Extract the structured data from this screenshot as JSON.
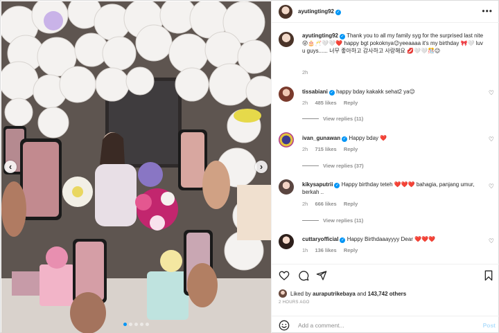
{
  "post": {
    "author": "ayutingting92",
    "caption_user": "ayutingting92",
    "caption": "Thank you to all my family syg for the surprised last nite 😜🎂🥂🤍🤍❤️ happy bgt pokoknya😉yeeaaaa it's my birthday 🎀🤍 luv u guys...... 너무 좋아하고 감사하고 사랑해요 💋🤍🤍🎊😉",
    "caption_time": "2h",
    "carousel": {
      "total": 5,
      "active": 0
    }
  },
  "comments": [
    {
      "user": "tissabiani",
      "verified": true,
      "text": "happy bday kakakk sehat2 ya😉",
      "time": "2h",
      "likes": "485 likes",
      "reply": "Reply",
      "view_replies": "View replies (11)"
    },
    {
      "user": "ivan_gunawan",
      "verified": true,
      "text": "Happy bday ❤️",
      "time": "2h",
      "likes": "715 likes",
      "reply": "Reply",
      "view_replies": "View replies (37)"
    },
    {
      "user": "kikysaputrii",
      "verified": true,
      "text": "Happy birthday teteh ❤️❤️❤️ bahagia, panjang umur, berkah ..",
      "time": "2h",
      "likes": "666 likes",
      "reply": "Reply",
      "view_replies": "View replies (11)"
    },
    {
      "user": "cuttaryofficial",
      "verified": true,
      "text": "Happy Birthdaaayyyy Dear ❤️❤️❤️",
      "time": "1h",
      "likes": "136 likes",
      "reply": "Reply"
    }
  ],
  "likes": {
    "prefix": "Liked by ",
    "user": "auraputrikebaya",
    "middle": " and ",
    "count": "143,742 others"
  },
  "timestamp": "2 HOURS AGO",
  "add_comment": {
    "placeholder": "Add a comment...",
    "post_label": "Post"
  },
  "colors": {
    "verified": "#0095f6",
    "muted": "#8e8e8e",
    "text": "#262626",
    "post_disabled": "#b3dffc"
  },
  "icons": [
    "more-icon",
    "heart-icon",
    "comment-icon",
    "share-icon",
    "bookmark-icon",
    "emoji-icon",
    "chevron-left-icon",
    "chevron-right-icon",
    "verified-icon"
  ]
}
